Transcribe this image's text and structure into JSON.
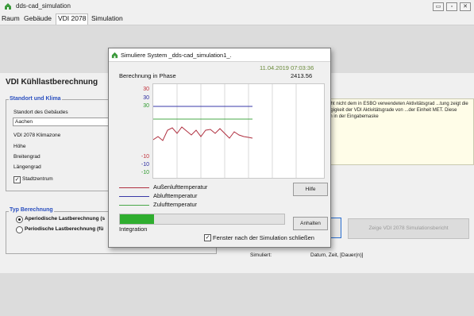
{
  "window": {
    "title": "dds-cad_simulation",
    "controls": {
      "minimize": "▭",
      "maximize": "▫",
      "close": "✕"
    }
  },
  "menu": {
    "items": [
      {
        "label": "Raum"
      },
      {
        "label": "Gebäude"
      },
      {
        "label": "VDI 2078"
      },
      {
        "label": "Simulation"
      }
    ]
  },
  "main": {
    "heading": "VDI Kühllastberechnung",
    "location_group": {
      "title": "Standort und Klima",
      "building_location_label": "Standort des Gebäudes",
      "building_location_value": "Aachen",
      "climate_zone_label": "VDI 2078 Klimazone",
      "height_label": "Höhe",
      "latitude_label": "Breitengrad",
      "longitude_label": "Längengrad",
      "city_center_label": "Stadtzentrum",
      "city_center_checked": true
    },
    "note_text": "...spricht nicht dem in ESBO verwendeten Aktivitätsgrad ...tung zeigt die Abhängigkeit der VDI Aktivitätsgrade von ...der Einheit MET. Diese können in der Eingabemaske",
    "calc_group": {
      "title": "Typ Berechnung",
      "option_aperiodic": "Aperiodische Lastberechnung (s",
      "option_periodic": "Periodische Lastberechnung (fü",
      "selected": "aperiodic"
    },
    "report_button": "Zeige VDI 2078 Simulationsbericht",
    "simulated_label": "Simuliert:",
    "simulated_value": "Datum, Zeit, [Dauer(n)]"
  },
  "dialog": {
    "title": "Simuliere System _dds-cad_simulation1_.",
    "timestamp": "11.04.2019 07:03:36",
    "phase_label": "Berechnung in Phase",
    "phase_value": "2413.56",
    "y_ticks_top": [
      "30",
      "30",
      "30"
    ],
    "y_ticks_bottom": [
      "-10",
      "-10",
      "-10"
    ],
    "legend": [
      {
        "label": "Außenlufttemperatur",
        "color": "#b03040"
      },
      {
        "label": "Ablufttemperatur",
        "color": "#3a3aa8"
      },
      {
        "label": "Zulufttemperatur",
        "color": "#4aa84a"
      }
    ],
    "help_button": "Hilfe",
    "stop_button": "Anhalten",
    "progress": 0.21,
    "progress_label": "Integration",
    "close_after_label": "Fenster nach der Simulation schließen",
    "close_after_checked": true,
    "colors": {
      "tick_red": "#c0303a",
      "tick_blue": "#2a2aa0",
      "tick_green": "#2e9a2e",
      "timestamp": "#6a8a3a"
    }
  }
}
